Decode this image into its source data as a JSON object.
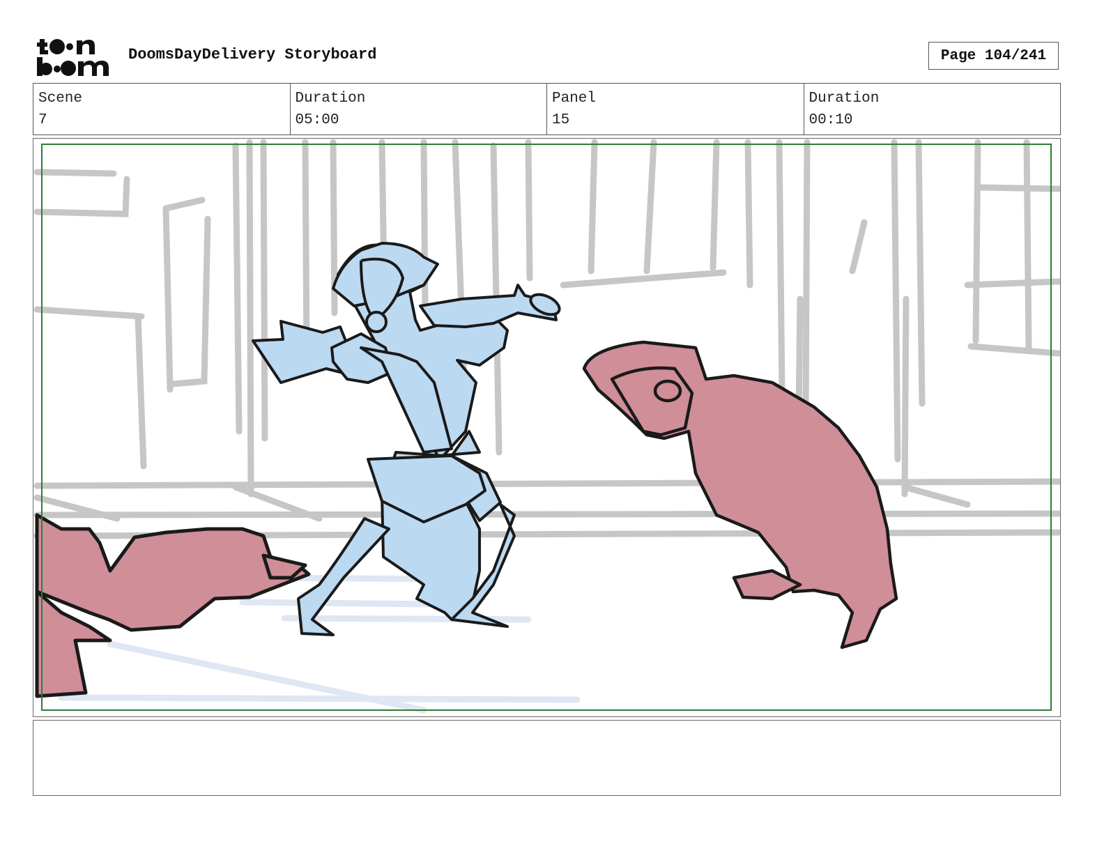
{
  "header": {
    "logo_text_top": "toon",
    "logo_text_bottom": "boom",
    "title": "DoomsDayDelivery Storyboard",
    "page_label": "Page 104/241"
  },
  "info": {
    "scene_label": "Scene",
    "scene_value": "7",
    "scene_duration_label": "Duration",
    "scene_duration_value": "05:00",
    "panel_label": "Panel",
    "panel_value": "15",
    "panel_duration_label": "Duration",
    "panel_duration_value": "00:10"
  },
  "colors": {
    "hero_fill": "#bcd9f2",
    "villain_fill": "#cf8e98",
    "background_lines": "#c6c6c6",
    "safe_frame": "#2e7d32",
    "ink": "#1a1a1a"
  },
  "notes": {
    "text": ""
  }
}
